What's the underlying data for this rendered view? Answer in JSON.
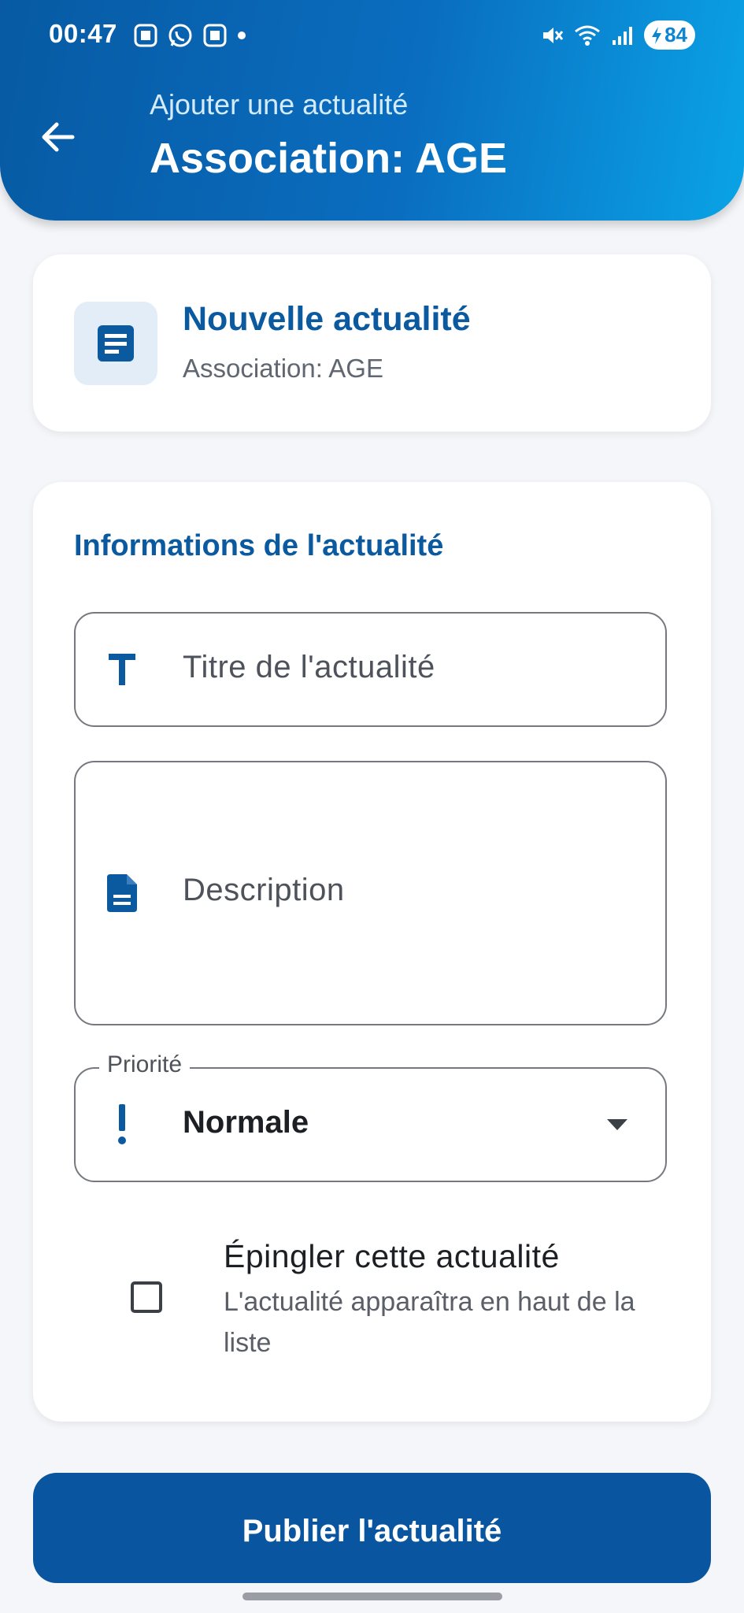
{
  "status_bar": {
    "time": "00:47",
    "battery": "84"
  },
  "header": {
    "subtitle": "Ajouter une actualité",
    "title": "Association: AGE"
  },
  "summary_card": {
    "title": "Nouvelle actualité",
    "subtitle": "Association: AGE"
  },
  "form": {
    "section_title": "Informations de l'actualité",
    "title_placeholder": "Titre de l'actualité",
    "description_placeholder": "Description",
    "priority_label": "Priorité",
    "priority_value": "Normale",
    "pin_title": "Épingler cette actualité",
    "pin_description": "L'actualité apparaîtra en haut de la liste",
    "pin_checked": false
  },
  "actions": {
    "publish_label": "Publier l'actualité"
  },
  "colors": {
    "primary": "#0b5aa0",
    "header_gradient_start": "#075aa3",
    "header_gradient_end": "#0aa3e6",
    "background": "#f4f6f9"
  }
}
